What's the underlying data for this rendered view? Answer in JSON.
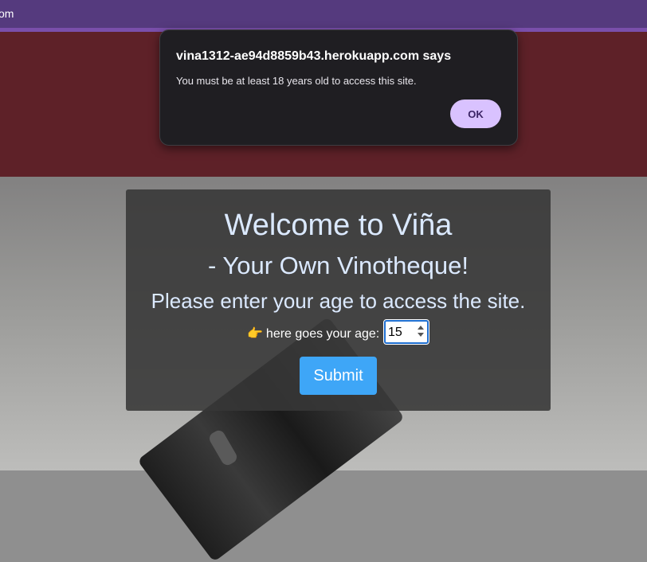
{
  "browser": {
    "tab_text": "om"
  },
  "dialog": {
    "title": "vina1312-ae94d8859b43.herokuapp.com says",
    "message": "You must be at least 18 years old to access this site.",
    "ok_label": "OK"
  },
  "panel": {
    "heading": "Welcome to Viña",
    "subheading": "- Your Own Vinotheque!",
    "instruction": "Please enter your age to access the site.",
    "age_label": "here goes your age:",
    "age_icon": "👉",
    "age_value": "15",
    "submit_label": "Submit"
  },
  "colors": {
    "panel_text": "#dbe9ff",
    "submit_bg": "#3ea6f7",
    "ok_bg": "#d9c2ff",
    "header_bg": "#5e2128"
  }
}
